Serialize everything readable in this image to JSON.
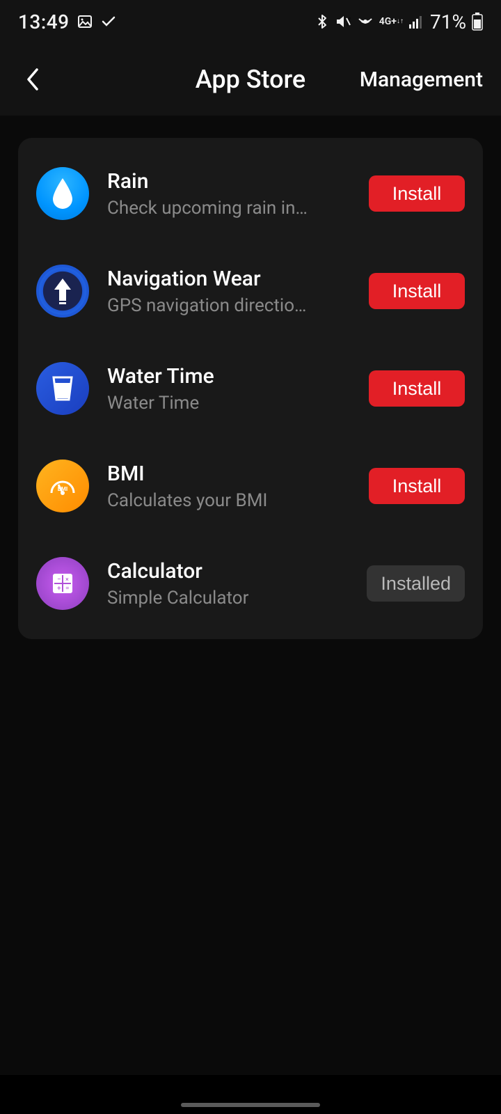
{
  "statusbar": {
    "time": "13:49",
    "battery": "71%"
  },
  "header": {
    "title": "App Store",
    "management": "Management"
  },
  "labels": {
    "install": "Install",
    "installed": "Installed"
  },
  "apps": [
    {
      "name": "Rain",
      "description": "Check upcoming rain in a …",
      "action": "install",
      "icon": "rain"
    },
    {
      "name": "Navigation Wear",
      "description": "GPS navigation directions …",
      "action": "install",
      "icon": "nav"
    },
    {
      "name": "Water Time",
      "description": "Water Time",
      "action": "install",
      "icon": "water"
    },
    {
      "name": "BMI",
      "description": "Calculates your BMI",
      "action": "install",
      "icon": "bmi"
    },
    {
      "name": "Calculator",
      "description": "Simple Calculator",
      "action": "installed",
      "icon": "calc"
    }
  ]
}
